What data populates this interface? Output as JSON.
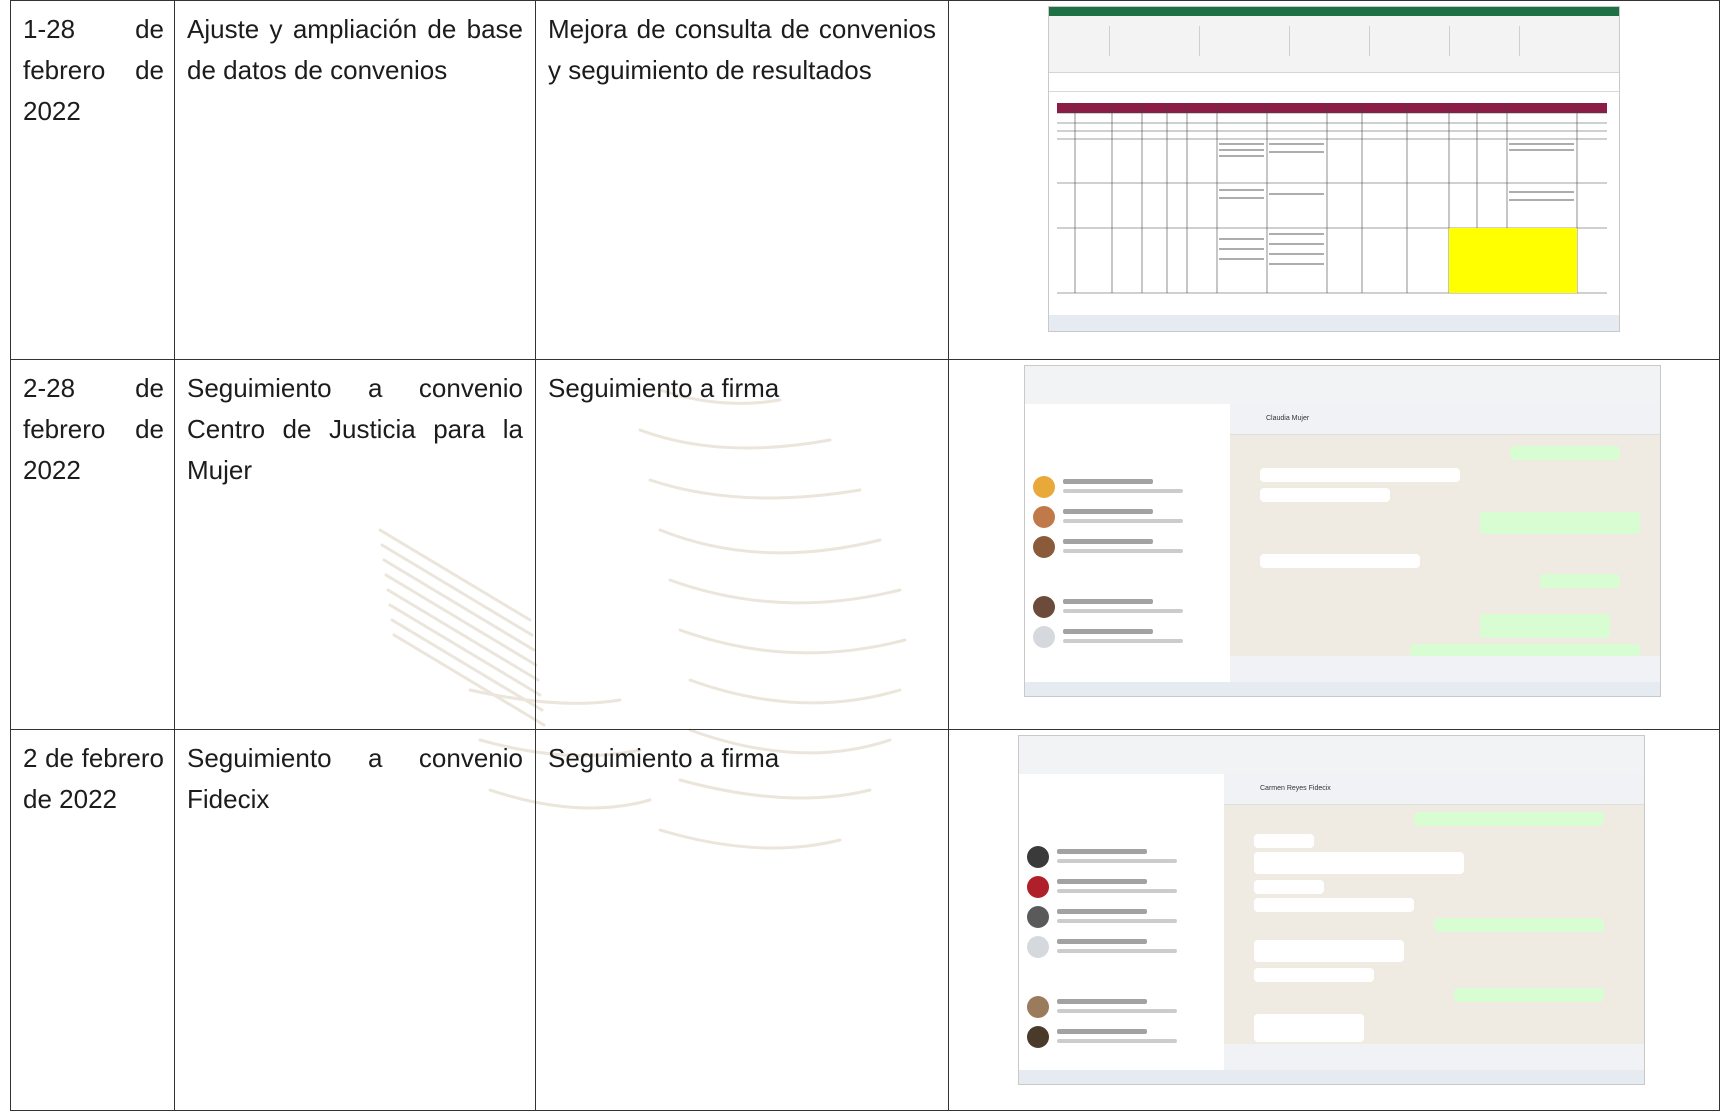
{
  "rows": [
    {
      "date": "1-28 de febrero de 2022",
      "activity": "Ajuste y ampliación de base de datos de convenios",
      "result": "Mejora de consulta de convenios y seguimiento de resultados",
      "evidence_kind": "spreadsheet-screenshot"
    },
    {
      "date": "2-28 de febrero de 2022",
      "activity": "Seguimiento a convenio Centro de Justicia para la Mujer",
      "result": "Seguimiento a firma",
      "evidence_kind": "chat-screenshot",
      "chat_title": "Claudia Mujer"
    },
    {
      "date": "2 de febrero de 2022",
      "activity": "Seguimiento a convenio Fidecix",
      "result": "Seguimiento a firma",
      "evidence_kind": "chat-screenshot",
      "chat_title": "Carmen Reyes Fidecix"
    }
  ],
  "colors": {
    "grid": "#333333",
    "excel_header": "#8b1c45",
    "excel_highlight": "#ffff00",
    "chat_outgoing": "#d9fdd3",
    "chat_background": "#efeae2",
    "watermark": "#c8b79a"
  }
}
